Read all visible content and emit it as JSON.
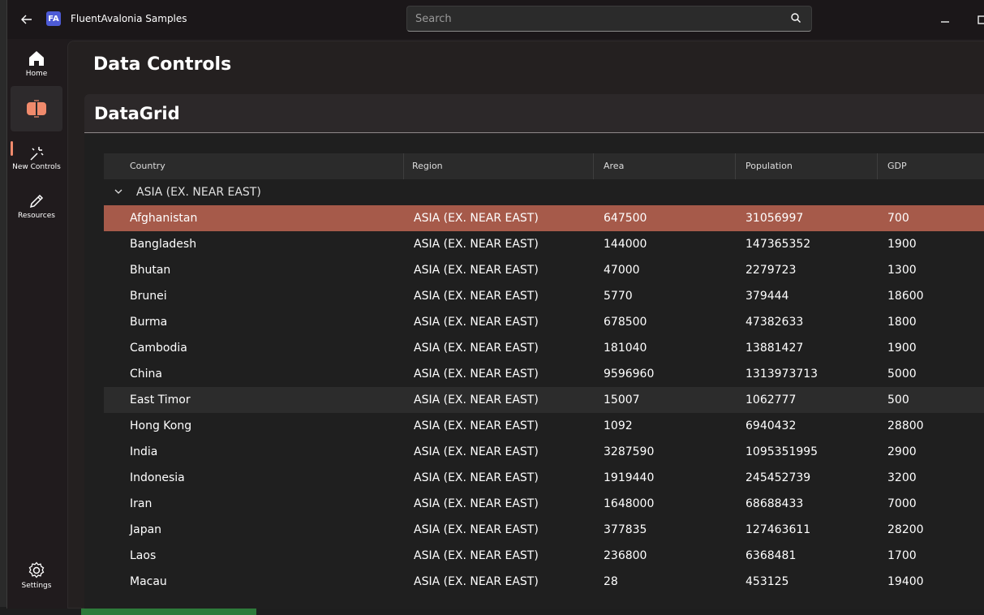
{
  "app": {
    "title": "FluentAvalonia Samples",
    "icon_text": "FA"
  },
  "search": {
    "placeholder": "Search"
  },
  "nav": {
    "items": [
      {
        "label": "Home",
        "icon": "home-icon"
      },
      {
        "label": "",
        "icon": "design-icon",
        "selected": true
      },
      {
        "label": "New Controls",
        "icon": "sparkle-icon"
      },
      {
        "label": "Resources",
        "icon": "pen-icon"
      }
    ],
    "settings_label": "Settings"
  },
  "page": {
    "title": "Data Controls"
  },
  "section": {
    "title": "DataGrid"
  },
  "grid": {
    "columns": [
      "Country",
      "Region",
      "Area",
      "Population",
      "GDP"
    ],
    "group_label": "ASIA (EX. NEAR EAST)",
    "rows": [
      {
        "country": "Afghanistan",
        "region": "ASIA (EX. NEAR EAST)",
        "area": "647500",
        "population": "31056997",
        "gdp": "700",
        "state": "selected"
      },
      {
        "country": "Bangladesh",
        "region": "ASIA (EX. NEAR EAST)",
        "area": "144000",
        "population": "147365352",
        "gdp": "1900"
      },
      {
        "country": "Bhutan",
        "region": "ASIA (EX. NEAR EAST)",
        "area": "47000",
        "population": "2279723",
        "gdp": "1300"
      },
      {
        "country": "Brunei",
        "region": "ASIA (EX. NEAR EAST)",
        "area": "5770",
        "population": "379444",
        "gdp": "18600"
      },
      {
        "country": "Burma",
        "region": "ASIA (EX. NEAR EAST)",
        "area": "678500",
        "population": "47382633",
        "gdp": "1800"
      },
      {
        "country": "Cambodia",
        "region": "ASIA (EX. NEAR EAST)",
        "area": "181040",
        "population": "13881427",
        "gdp": "1900"
      },
      {
        "country": "China",
        "region": "ASIA (EX. NEAR EAST)",
        "area": "9596960",
        "population": "1313973713",
        "gdp": "5000"
      },
      {
        "country": "East Timor",
        "region": "ASIA (EX. NEAR EAST)",
        "area": "15007",
        "population": "1062777",
        "gdp": "500",
        "state": "hover"
      },
      {
        "country": "Hong Kong",
        "region": "ASIA (EX. NEAR EAST)",
        "area": "1092",
        "population": "6940432",
        "gdp": "28800"
      },
      {
        "country": "India",
        "region": "ASIA (EX. NEAR EAST)",
        "area": "3287590",
        "population": "1095351995",
        "gdp": "2900"
      },
      {
        "country": "Indonesia",
        "region": "ASIA (EX. NEAR EAST)",
        "area": "1919440",
        "population": "245452739",
        "gdp": "3200"
      },
      {
        "country": "Iran",
        "region": "ASIA (EX. NEAR EAST)",
        "area": "1648000",
        "population": "68688433",
        "gdp": "7000"
      },
      {
        "country": "Japan",
        "region": "ASIA (EX. NEAR EAST)",
        "area": "377835",
        "population": "127463611",
        "gdp": "28200"
      },
      {
        "country": "Laos",
        "region": "ASIA (EX. NEAR EAST)",
        "area": "236800",
        "population": "6368481",
        "gdp": "1700"
      },
      {
        "country": "Macau",
        "region": "ASIA (EX. NEAR EAST)",
        "area": "28",
        "population": "453125",
        "gdp": "19400"
      }
    ]
  },
  "colors": {
    "accent": "#f08a6c",
    "selected_row": "#a65a4a"
  }
}
